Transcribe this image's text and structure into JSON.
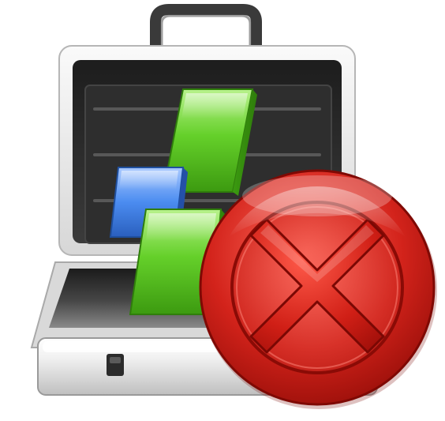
{
  "image": {
    "background_color": "#ffffff",
    "icon_name": "briefcase-remove-icon"
  },
  "briefcase": {
    "icon_name": "briefcase-icon",
    "body_color": "#e6e6e6",
    "interior_color": "#2b2b2b",
    "handle_color": "#3a3a3a"
  },
  "blocks": {
    "icon_name": "stacked-blocks-icon",
    "primary_color": "#55c31f",
    "secondary_color": "#3f7fd6"
  },
  "badge": {
    "icon_name": "red-circle-x-icon",
    "color": "#d21c16"
  }
}
